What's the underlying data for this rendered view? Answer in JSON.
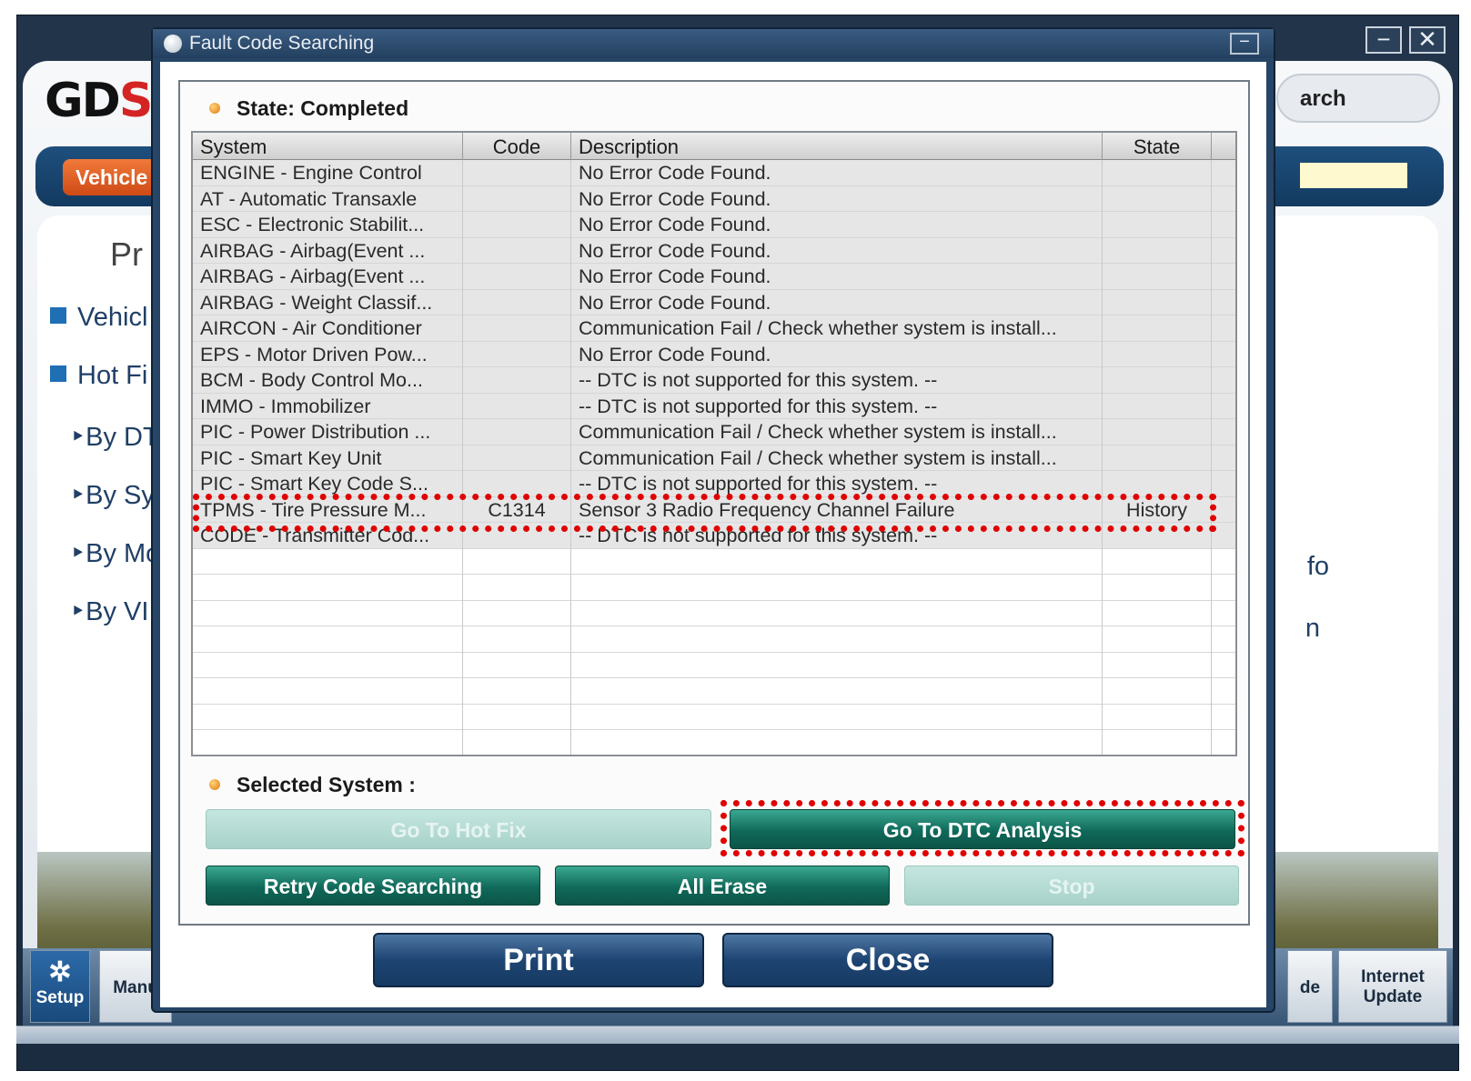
{
  "background_app": {
    "logo": "GD",
    "logo_accent": "S",
    "search_text": "arch",
    "vehicle_tab": "Vehicle",
    "panel_title": "Pr",
    "sidebar": [
      {
        "label": "Vehicl"
      },
      {
        "label": "Hot Fi"
      }
    ],
    "sidebar_sub": [
      {
        "label": "By DT"
      },
      {
        "label": "By Sy"
      },
      {
        "label": "By Mo"
      },
      {
        "label": "By VI"
      }
    ],
    "right_labels": [
      "fo",
      "n"
    ],
    "dock": {
      "setup": "Setup",
      "manual": "Manu",
      "de": "de",
      "update_line1": "Internet",
      "update_line2": "Update"
    },
    "window_controls": {
      "minimize": "−",
      "close": "✕"
    }
  },
  "dialog": {
    "title": "Fault Code Searching",
    "minimize": "−",
    "state_label": "State: Completed",
    "table": {
      "headers": {
        "system": "System",
        "code": "Code",
        "description": "Description",
        "state": "State"
      },
      "rows": [
        {
          "system": "ENGINE - Engine Control",
          "code": "",
          "description": "No Error Code Found.",
          "state": ""
        },
        {
          "system": "AT - Automatic Transaxle",
          "code": "",
          "description": "No Error Code Found.",
          "state": ""
        },
        {
          "system": "ESC - Electronic Stabilit...",
          "code": "",
          "description": "No Error Code Found.",
          "state": ""
        },
        {
          "system": "AIRBAG - Airbag(Event ...",
          "code": "",
          "description": "No Error Code Found.",
          "state": ""
        },
        {
          "system": "AIRBAG - Airbag(Event ...",
          "code": "",
          "description": "No Error Code Found.",
          "state": ""
        },
        {
          "system": "AIRBAG - Weight Classif...",
          "code": "",
          "description": "No Error Code Found.",
          "state": ""
        },
        {
          "system": "AIRCON - Air Conditioner",
          "code": "",
          "description": "Communication Fail / Check whether system is install...",
          "state": ""
        },
        {
          "system": "EPS - Motor Driven Pow...",
          "code": "",
          "description": "No Error Code Found.",
          "state": ""
        },
        {
          "system": "BCM - Body Control Mo...",
          "code": "",
          "description": "-- DTC is not supported for this system. --",
          "state": ""
        },
        {
          "system": "IMMO - Immobilizer",
          "code": "",
          "description": "-- DTC is not supported for this system. --",
          "state": ""
        },
        {
          "system": "PIC - Power Distribution ...",
          "code": "",
          "description": "Communication Fail / Check whether system is install...",
          "state": ""
        },
        {
          "system": "PIC - Smart Key Unit",
          "code": "",
          "description": "Communication Fail / Check whether system is install...",
          "state": ""
        },
        {
          "system": "PIC - Smart Key Code S...",
          "code": "",
          "description": "-- DTC is not supported for this system. --",
          "state": ""
        },
        {
          "system": "TPMS - Tire Pressure M...",
          "code": "C1314",
          "description": "Sensor 3 Radio Frequency Channel Failure",
          "state": "History"
        },
        {
          "system": "CODE - Transmitter Cod...",
          "code": "",
          "description": "-- DTC is not supported for this system. --",
          "state": ""
        }
      ]
    },
    "selected_system_label": "Selected System :",
    "buttons": {
      "hot_fix": "Go To Hot Fix",
      "dtc_analysis": "Go To DTC Analysis",
      "retry": "Retry Code Searching",
      "all_erase": "All Erase",
      "stop": "Stop",
      "print": "Print",
      "close": "Close"
    }
  },
  "colors": {
    "highlight": "#e00000",
    "green_button": "#10695a",
    "blue_button": "#1d4472",
    "accent_orange": "#e07a10"
  }
}
